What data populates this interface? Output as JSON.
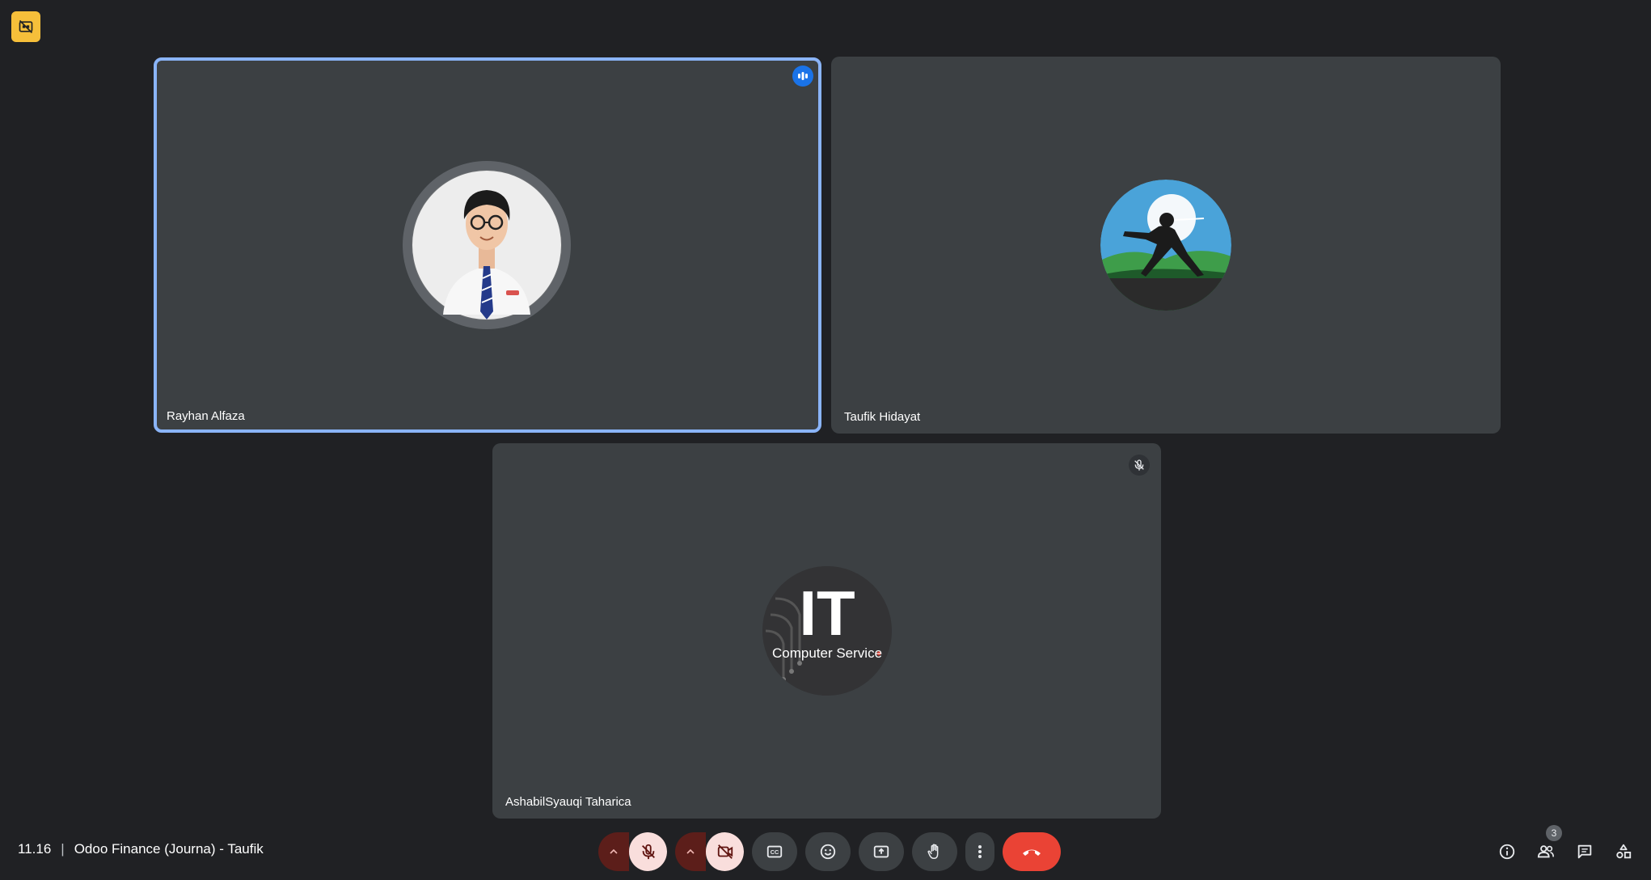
{
  "participants": [
    {
      "name": "Rayhan Alfaza",
      "speaking": true
    },
    {
      "name": "Taufik Hidayat",
      "speaking": false
    },
    {
      "name": "AshabilSyauqi Taharica",
      "muted": true
    }
  ],
  "avatar_logo": {
    "big_text": "IT",
    "small_text": "Computer Service"
  },
  "meeting": {
    "time": "11.16",
    "separator": "|",
    "title": "Odoo Finance (Journa) - Taufik"
  },
  "people_count": "3",
  "colors": {
    "background": "#202124",
    "tile": "#3c4043",
    "active_outline": "#8ab4f8",
    "end_call": "#ea4335",
    "badge": "#f6bf3a"
  },
  "icons": {
    "top_badge": "closed-caption-off-icon",
    "mic": "mic-off-icon",
    "camera": "videocam-off-icon",
    "captions": "closed-caption-icon",
    "emoji": "emoji-icon",
    "present": "present-screen-icon",
    "hand": "raise-hand-icon",
    "more": "more-vert-icon",
    "end": "call-end-icon",
    "info": "info-icon",
    "people": "people-icon",
    "chat": "chat-icon",
    "activities": "activities-icon"
  }
}
